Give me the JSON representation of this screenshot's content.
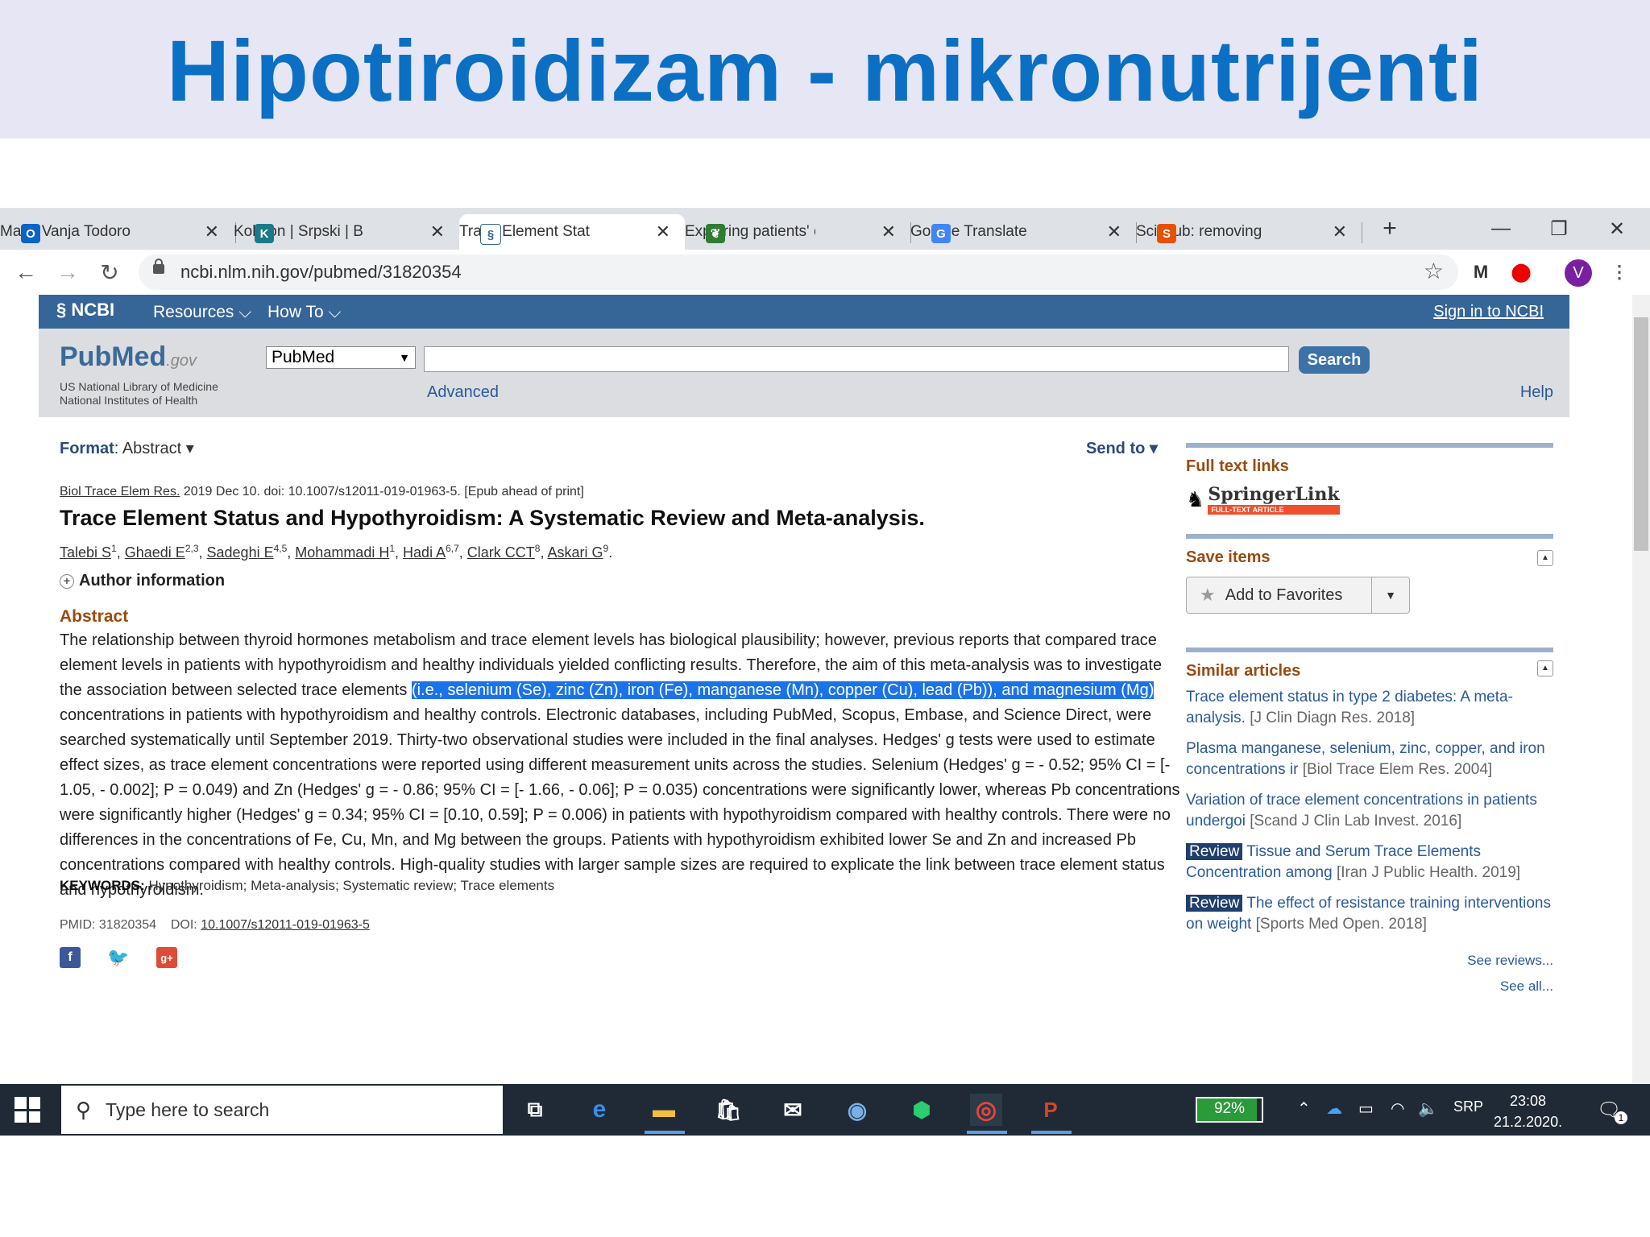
{
  "slide": {
    "title": "Hipotiroidizam - mikronutrijenti"
  },
  "browser": {
    "tabs": [
      {
        "label": "Mail - Vanja Todorov",
        "icon": "outlook-icon"
      },
      {
        "label": "Kobson | Srpski | Brz",
        "icon": "kobson-icon"
      },
      {
        "label": "Trace Element Status",
        "icon": "ncbi-icon",
        "active": true
      },
      {
        "label": "Exploring patients' e",
        "icon": "plant-icon"
      },
      {
        "label": "Google Translate",
        "icon": "google-translate-icon"
      },
      {
        "label": "Sci-Hub: removing b",
        "icon": "scihub-icon"
      }
    ],
    "new_tab": "+",
    "window_controls": {
      "minimize": "—",
      "restore": "❐",
      "close": "✕"
    },
    "url": "ncbi.nlm.nih.gov/pubmed/31820354",
    "profile_initial": "V"
  },
  "ncbi": {
    "logo": "NCBI",
    "resources": "Resources",
    "howto": "How To",
    "signin": "Sign in to NCBI"
  },
  "pubmed": {
    "logo": "PubMed",
    "logo_gov": ".gov",
    "org_line1": "US National Library of Medicine",
    "org_line2": "National Institutes of Health",
    "database": "PubMed",
    "search_value": "",
    "search_button": "Search",
    "advanced": "Advanced",
    "help": "Help"
  },
  "article": {
    "format_label": "Format",
    "format_value": "Abstract",
    "send_to": "Send to",
    "journal": "Biol Trace Elem Res.",
    "citation_rest": "2019 Dec 10. doi: 10.1007/s12011-019-01963-5. [Epub ahead of print]",
    "title": "Trace Element Status and Hypothyroidism: A Systematic Review and Meta-analysis.",
    "authors": [
      {
        "name": "Talebi S",
        "sup": "1"
      },
      {
        "name": "Ghaedi E",
        "sup": "2,3"
      },
      {
        "name": "Sadeghi E",
        "sup": "4,5"
      },
      {
        "name": "Mohammadi H",
        "sup": "1"
      },
      {
        "name": "Hadi A",
        "sup": "6,7"
      },
      {
        "name": "Clark CCT",
        "sup": "8"
      },
      {
        "name": "Askari G",
        "sup": "9"
      }
    ],
    "author_info": "Author information",
    "abstract_heading": "Abstract",
    "abstract_pre": "The relationship between thyroid hormones metabolism and trace element levels has biological plausibility; however, previous reports that compared trace element levels in patients with hypothyroidism and healthy individuals yielded conflicting results. Therefore, the aim of this meta-analysis was to investigate the association between selected trace elements ",
    "abstract_highlight": "(i.e., selenium (Se), zinc (Zn), iron (Fe), manganese (Mn), copper (Cu), lead (Pb)), and magnesium (Mg)",
    "abstract_post": " concentrations in patients with hypothyroidism and healthy controls. Electronic databases, including PubMed, Scopus, Embase, and Science Direct, were searched systematically until September 2019. Thirty-two observational studies were included in the final analyses. Hedges' g tests were used to estimate effect sizes, as trace element concentrations were reported using different measurement units across the studies. Selenium (Hedges' g = - 0.52; 95% CI = [- 1.05, - 0.002]; P = 0.049) and Zn (Hedges' g = - 0.86; 95% CI = [- 1.66, - 0.06]; P = 0.035) concentrations were significantly lower, whereas Pb concentrations were significantly higher (Hedges' g = 0.34; 95% CI = [0.10, 0.59]; P = 0.006) in patients with hypothyroidism compared with healthy controls. There were no differences in the concentrations of Fe, Cu, Mn, and Mg between the groups. Patients with hypothyroidism exhibited lower Se and Zn and increased Pb concentrations compared with healthy controls. High-quality studies with larger sample sizes are required to explicate the link between trace element status and hypothyroidism.",
    "keywords_label": "KEYWORDS:",
    "keywords": "Hypothyroidism; Meta-analysis; Systematic review; Trace elements",
    "pmid": "PMID: 31820354",
    "doi_label": "DOI:",
    "doi": "10.1007/s12011-019-01963-5"
  },
  "sidebar": {
    "full_text_title": "Full text links",
    "springer_name": "SpringerLink",
    "springer_badge": "FULL-TEXT ARTICLE",
    "save_title": "Save items",
    "add_favorites": "Add to Favorites",
    "similar_title": "Similar articles",
    "similar": [
      {
        "badge": "",
        "title": "Trace element status in type 2 diabetes: A meta-analysis.",
        "source": "[J Clin Diagn Res. 2018]"
      },
      {
        "badge": "",
        "title": "Plasma manganese, selenium, zinc, copper, and iron concentrations ir",
        "source": "[Biol Trace Elem Res. 2004]"
      },
      {
        "badge": "",
        "title": "Variation of trace element concentrations in patients undergoi",
        "source": "[Scand J Clin Lab Invest. 2016]"
      },
      {
        "badge": "Review",
        "title": "Tissue and Serum Trace Elements Concentration among",
        "source": "[Iran J Public Health. 2019]"
      },
      {
        "badge": "Review",
        "title": "The effect of resistance training interventions on weight",
        "source": "[Sports Med Open. 2018]"
      }
    ],
    "see_reviews": "See reviews...",
    "see_all": "See all..."
  },
  "taskbar": {
    "search_placeholder": "Type here to search",
    "battery": "92%",
    "battery_level": 0.92,
    "language": "SRP",
    "time": "23:08",
    "date": "21.2.2020.",
    "notification_count": "1"
  }
}
